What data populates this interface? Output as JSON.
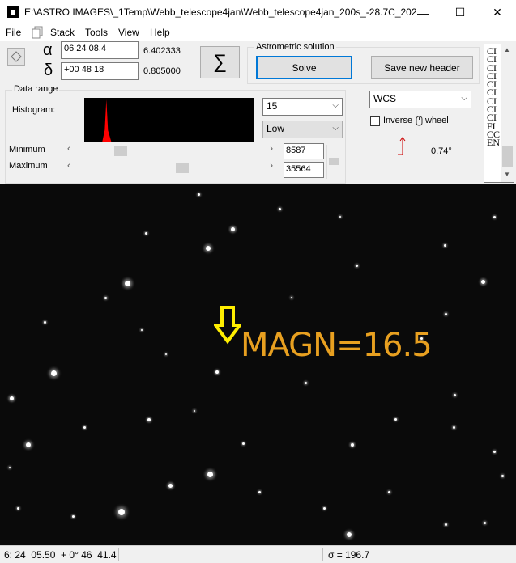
{
  "window": {
    "title": "E:\\ASTRO IMAGES\\_1Temp\\Webb_telescope4jan\\Webb_telescope4jan_200s_-28.7C_202...",
    "minimize_glyph": "—",
    "maximize_glyph": "☐",
    "close_glyph": "✕"
  },
  "menu": {
    "file": "File",
    "stack": "Stack",
    "tools": "Tools",
    "view": "View",
    "help": "Help"
  },
  "coords": {
    "alpha_symbol": "α",
    "alpha_value": "06 24 08.4",
    "alpha_decimal": "6.402333",
    "delta_symbol": "δ",
    "delta_value": "+00 48 18",
    "delta_decimal": "0.805000",
    "sigma_glyph": "∑"
  },
  "astrometric": {
    "group_label": "Astrometric solution",
    "solve_label": "Solve",
    "save_header_label": "Save new header"
  },
  "data_range": {
    "group_label": "Data range",
    "histogram_label": "Histogram:",
    "minimum_label": "Minimum",
    "maximum_label": "Maximum",
    "minimum_value": "8587",
    "maximum_value": "35564",
    "dropdown_value": "15",
    "range_mode": "Low",
    "minimum_position": 0.19,
    "maximum_position": 0.53,
    "histogram_peak_position": 0.13,
    "histogram_color": "#ff0000"
  },
  "wcs": {
    "mode": "WCS",
    "inverse_wheel_label": "Inverse",
    "wheel_label": "wheel",
    "inverse_checked": false,
    "angle_label": "0.74°"
  },
  "header_list": {
    "lines": [
      "CI",
      "CI",
      "CI",
      "CI",
      "CI",
      "CI",
      "CI",
      "CI",
      "CI",
      "FI",
      "CC",
      "EN"
    ]
  },
  "image": {
    "annotation_text": "MAGN=16.5",
    "annotation_color": "#e8a020",
    "arrow_color": "#ffee00"
  },
  "status": {
    "position": "6: 24  05.50  + 0° 46  41.4",
    "sigma": "σ = 196.7"
  }
}
